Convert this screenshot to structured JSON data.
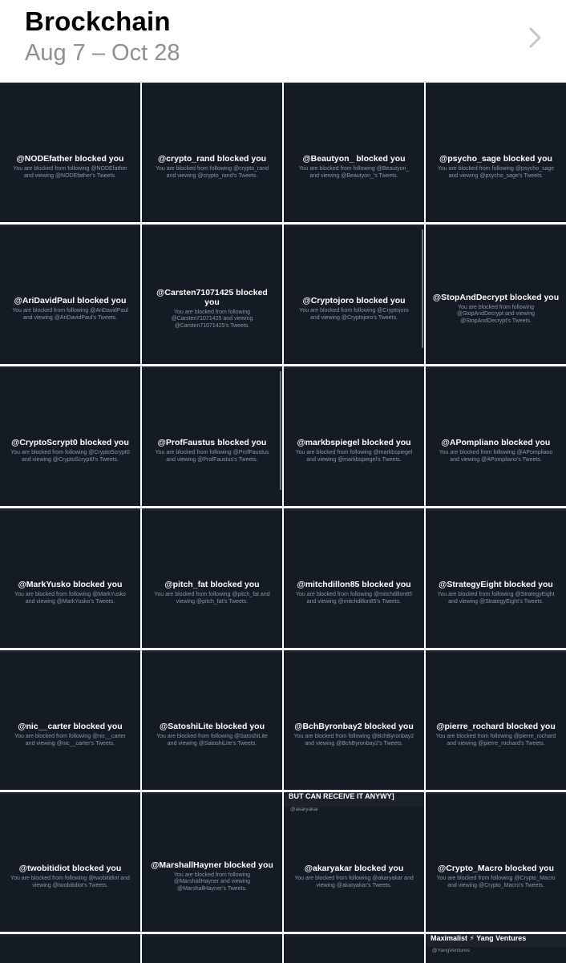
{
  "album": {
    "title": "Brockchain",
    "subtitle": "Aug 7 – Oct 28"
  },
  "colors": {
    "tile_background": "#151b24",
    "heading_text": "#ffffff",
    "description_text": "#8899a6",
    "subtitle_gray": "#8e8e93"
  },
  "tiles": [
    {
      "heading": "@NODEfather blocked you",
      "description": "You are blocked from following @NODEfather and viewing @NODEfather's Tweets."
    },
    {
      "heading": "@crypto_rand blocked you",
      "description": "You are blocked from following @crypto_rand and viewing @crypto_rand's Tweets."
    },
    {
      "heading": "@Beautyon_ blocked you",
      "description": "You are blocked from following @Beautyon_ and viewing @Beautyon_'s Tweets."
    },
    {
      "heading": "@psycho_sage blocked you",
      "description": "You are blocked from following @psycho_sage and viewing @psycho_sage's Tweets."
    },
    {
      "heading": "@AriDavidPaul blocked you",
      "description": "You are blocked from following @AriDavidPaul and viewing @AriDavidPaul's Tweets."
    },
    {
      "heading": "@Carsten71071425 blocked you",
      "description": "You are blocked from following @Carsten71071425 and viewing @Carsten71071425's Tweets."
    },
    {
      "heading": "@Cryptojoro blocked you",
      "description": "You are blocked from following @Cryptojoro and viewing @Cryptojoro's Tweets."
    },
    {
      "heading": "@StopAndDecrypt blocked you",
      "description": "You are blocked from following @StopAndDecrypt and viewing @StopAndDecrypt's Tweets."
    },
    {
      "heading": "@CryptoScrypt0 blocked you",
      "description": "You are blocked from following @CryptoScrypt0 and viewing @CryptoScrypt0's Tweets."
    },
    {
      "heading": "@ProfFaustus blocked you",
      "description": "You are blocked from following @ProfFaustus and viewing @ProfFaustus's Tweets."
    },
    {
      "heading": "@markbspiegel blocked you",
      "description": "You are blocked from following @markbspiegel and viewing @markbspiegel's Tweets."
    },
    {
      "heading": "@APompliano blocked you",
      "description": "You are blocked from following @APompliano and viewing @APompliano's Tweets."
    },
    {
      "heading": "@MarkYusko blocked you",
      "description": "You are blocked from following @MarkYusko and viewing @MarkYusko's Tweets."
    },
    {
      "heading": "@pitch_fat blocked you",
      "description": "You are blocked from following @pitch_fat and viewing @pitch_fat's Tweets."
    },
    {
      "heading": "@mitchdillon85 blocked you",
      "description": "You are blocked from following @mitchdillon85 and viewing @mitchdillon85's Tweets."
    },
    {
      "heading": "@StrategyEight blocked you",
      "description": "You are blocked from following @StrategyEight and viewing @StrategyEight's Tweets."
    },
    {
      "heading": "@nic__carter blocked you",
      "description": "You are blocked from following @nic__carter and viewing @nic__carter's Tweets."
    },
    {
      "heading": "@SatoshiLite blocked you",
      "description": "You are blocked from following @SatoshiLite and viewing @SatoshiLite's Tweets."
    },
    {
      "heading": "@BchByronbay2 blocked you",
      "description": "You are blocked from following @BchByronbay2 and viewing @BchByronbay2's Tweets."
    },
    {
      "heading": "@pierre_rochard blocked you",
      "description": "You are blocked from following @pierre_rochard and viewing @pierre_rochard's Tweets."
    },
    {
      "heading": "@twobitidiot blocked you",
      "description": "You are blocked from following @twobitidiot and viewing @twobitidiot's Tweets."
    },
    {
      "heading": "@MarshallHayner blocked you",
      "description": "You are blocked from following @MarshallHayner and viewing @MarshallHayner's Tweets."
    },
    {
      "heading": "@akaryakar blocked you",
      "description": "You are blocked from following @akaryakar and viewing @akaryakar's Tweets."
    },
    {
      "heading": "@Crypto_Macro blocked you",
      "description": "You are blocked from following @Crypto_Macro and viewing @Crypto_Macro's Tweets."
    }
  ],
  "overlays": {
    "akaryakar_top_title": "BUT CAN RECEIVE IT ANYWY]",
    "akaryakar_top_handle": "@akaryakar",
    "bottom_right_title": "Maximalist ⚡ Yang Ventures",
    "bottom_right_handle": "@YangVentures"
  }
}
